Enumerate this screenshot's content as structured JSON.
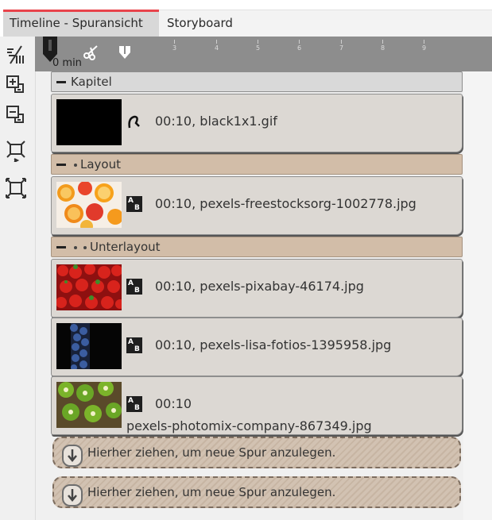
{
  "tabs": [
    {
      "label": "Timeline - Spuransicht",
      "active": true
    },
    {
      "label": "Storyboard",
      "active": false
    }
  ],
  "ruler": {
    "minute_label": "0 min",
    "ticks": [
      "3",
      "4",
      "5",
      "6",
      "7",
      "8",
      "9"
    ]
  },
  "toolbar_icons": [
    "fit-timeline-icon",
    "expand-all-icon",
    "collapse-all-icon",
    "zoom-in-icon",
    "zoom-fit-icon"
  ],
  "tracks": {
    "kapitel_label": "Kapitel",
    "layout_label": "Layout",
    "unterlayout_label": "Unterlayout",
    "clips": [
      {
        "text": "00:10, black1x1.gif"
      },
      {
        "text": "00:10, pexels-freestocksorg-1002778.jpg"
      },
      {
        "text": "00:10, pexels-pixabay-46174.jpg"
      },
      {
        "text": "00:10, pexels-lisa-fotios-1395958.jpg"
      },
      {
        "text_line1": "00:10",
        "text_line2": "pexels-photomix-company-867349.jpg"
      }
    ],
    "dropzone_label": "Hierher ziehen, um neue Spur anzulegen."
  },
  "colors": {
    "accent": "#e8434b",
    "ruler_bg": "#8d8d8d",
    "layout_header_bg": "#d2bda8",
    "clip_bg": "#dcd8d3"
  }
}
